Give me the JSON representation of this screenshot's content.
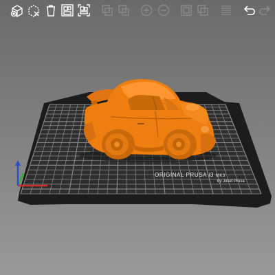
{
  "app": {
    "view": "3D"
  },
  "toolbar": {
    "buttons": [
      {
        "name": "add-object-button",
        "icon": "cube-plus-icon",
        "enabled": true
      },
      {
        "name": "delete-button",
        "icon": "cube-x-icon",
        "enabled": true
      },
      {
        "name": "delete-all-button",
        "icon": "trash-icon",
        "enabled": true
      },
      {
        "name": "arrange-button",
        "icon": "arrange-icon",
        "enabled": true
      },
      {
        "name": "arrange-selection-button",
        "icon": "arrange-selection-icon",
        "enabled": true
      },
      {
        "name": "copy-button",
        "icon": "copy-icon",
        "enabled": false
      },
      {
        "name": "paste-button",
        "icon": "paste-icon",
        "enabled": false
      },
      {
        "name": "add-instance-button",
        "icon": "plus-circle-icon",
        "enabled": false
      },
      {
        "name": "remove-instance-button",
        "icon": "minus-circle-icon",
        "enabled": false
      },
      {
        "name": "split-objects-button",
        "icon": "split-objects-icon",
        "enabled": false
      },
      {
        "name": "split-parts-button",
        "icon": "split-parts-icon",
        "enabled": false
      },
      {
        "name": "layers-editing-button",
        "icon": "layers-icon",
        "enabled": false
      },
      {
        "name": "undo-button",
        "icon": "undo-icon",
        "enabled": true
      },
      {
        "name": "redo-button",
        "icon": "redo-icon",
        "enabled": false
      }
    ]
  },
  "bed": {
    "label_line1": "ORIGINAL PRUSA i3",
    "label_line1_suffix": "MK3",
    "label_line2": "by Josef Prusa"
  },
  "model": {
    "color": "#ee7e10",
    "shade": "#b85e06",
    "highlight": "#ff9d3a"
  },
  "colors": {
    "bed_surface": "#2d2d2d",
    "bed_grid": "#8a8a8a",
    "bed_rim": "#1c1c1c",
    "axis_x": "#d42a2a",
    "axis_y": "#2fae2f",
    "axis_z": "#2d4ecb"
  }
}
